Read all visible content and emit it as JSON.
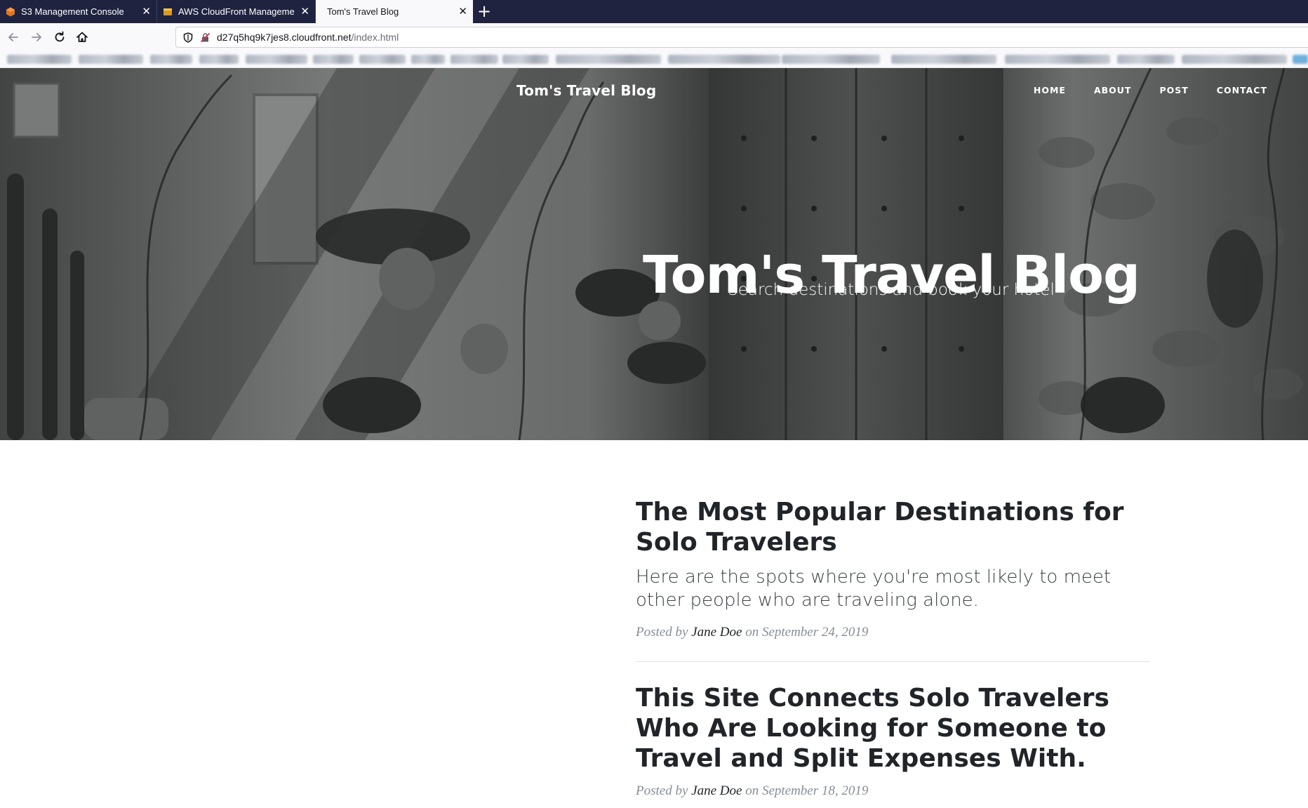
{
  "browser": {
    "tabs": [
      {
        "title": "S3 Management Console",
        "icon": "aws-s3-icon",
        "active": false
      },
      {
        "title": "AWS CloudFront Management",
        "icon": "aws-cloudfront-icon",
        "active": false
      },
      {
        "title": "Tom's Travel Blog",
        "icon": "",
        "active": true
      }
    ],
    "new_tab_glyph": "+",
    "close_glyph": "✕",
    "url_host": "d27q5hq9k7jes8.cloudfront.net",
    "url_path": "/index.html"
  },
  "site": {
    "brand": "Tom's Travel Blog",
    "nav": [
      "Home",
      "About",
      "Post",
      "Contact"
    ],
    "hero_title": "Tom's Travel Blog",
    "hero_subtitle": "Search destinations and book your hotel"
  },
  "posts": [
    {
      "title": "The Most Popular Destinations for Solo Travelers",
      "subtitle": "Here are the spots where you're most likely to meet other people who are traveling alone.",
      "meta_prefix": "Posted by",
      "author": "Jane Doe",
      "meta_on": "on",
      "date": "September 24, 2019"
    },
    {
      "title": "This Site Connects Solo Travelers Who Are Looking for Someone to Travel and Split Expenses With.",
      "subtitle": "",
      "meta_prefix": "Posted by",
      "author": "Jane Doe",
      "meta_on": "on",
      "date": "September 18, 2019"
    }
  ],
  "colors": {
    "tabbar_bg": "#1f2340",
    "title_text": "#212529",
    "meta_text": "#868e96",
    "s3_orange": "#e8731c",
    "cloudfront_gold": "#d89a1e"
  }
}
